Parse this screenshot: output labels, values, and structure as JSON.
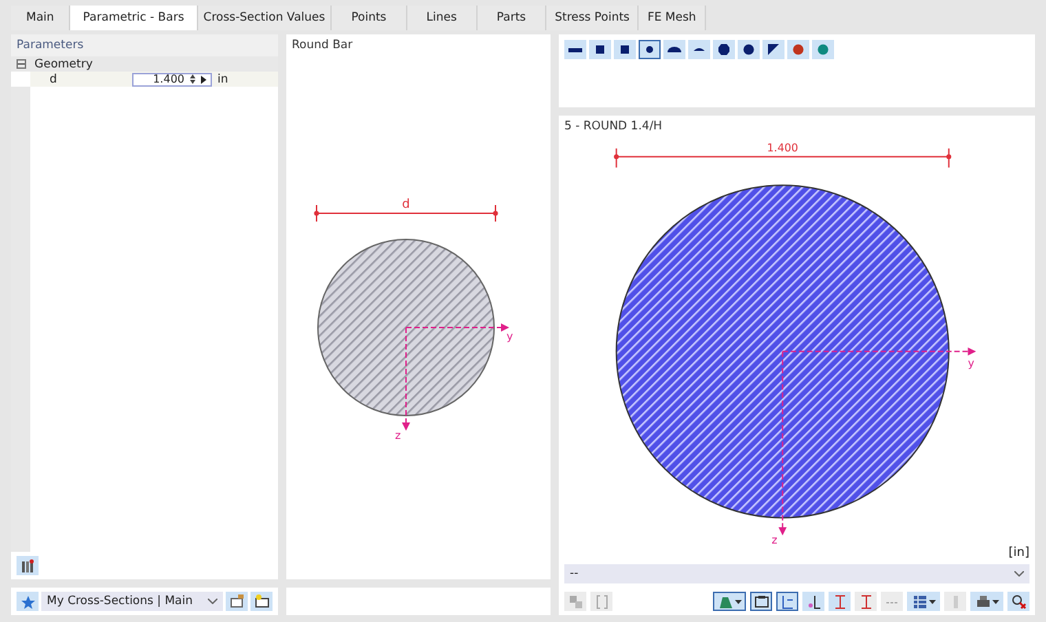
{
  "tabs": [
    {
      "label": "Main",
      "selected": false
    },
    {
      "label": "Parametric - Bars",
      "selected": true
    },
    {
      "label": "Cross-Section Values",
      "selected": false
    },
    {
      "label": "Points",
      "selected": false
    },
    {
      "label": "Lines",
      "selected": false
    },
    {
      "label": "Parts",
      "selected": false
    },
    {
      "label": "Stress Points",
      "selected": false
    },
    {
      "label": "FE Mesh",
      "selected": false
    }
  ],
  "parameters": {
    "title": "Parameters",
    "groups": [
      {
        "label": "Geometry",
        "expanded": true,
        "children": [
          {
            "name": "d",
            "value": "1.400",
            "unit": "in"
          }
        ]
      }
    ]
  },
  "library_selector": {
    "value": "My Cross-Sections | Main"
  },
  "sketch": {
    "title": "Round Bar",
    "dimension_label": "d",
    "axis_y": "y",
    "axis_z": "z"
  },
  "shapes": [
    {
      "kind": "flat",
      "selected": false,
      "color": "#0a1f6e"
    },
    {
      "kind": "square",
      "selected": false,
      "color": "#0a1f6e"
    },
    {
      "kind": "square",
      "selected": false,
      "color": "#0a1f6e"
    },
    {
      "kind": "dot",
      "selected": true,
      "color": "#0a1f6e"
    },
    {
      "kind": "half",
      "selected": false,
      "color": "#0a1f6e"
    },
    {
      "kind": "segment",
      "selected": false,
      "color": "#0a1f6e"
    },
    {
      "kind": "octagon",
      "selected": false,
      "color": "#0a1f6e"
    },
    {
      "kind": "circle",
      "selected": false,
      "color": "#0a1f6e"
    },
    {
      "kind": "triangle",
      "selected": false,
      "color": "#0a1f6e"
    },
    {
      "kind": "diamond",
      "selected": false,
      "color": "#c0341d"
    },
    {
      "kind": "diamond",
      "selected": false,
      "color": "#0f8a80"
    }
  ],
  "preview": {
    "title": "5 - ROUND 1.4/H",
    "dimension_label": "1.400",
    "axis_y": "y",
    "axis_z": "z",
    "unit": "[in]",
    "selector": "--"
  },
  "toolbar": [
    {
      "kind": "swap",
      "disabled": true,
      "selected": false,
      "dropdown": false
    },
    {
      "kind": "bracket",
      "disabled": true,
      "selected": false,
      "dropdown": false
    },
    {
      "kind": "view",
      "disabled": false,
      "selected": true,
      "dropdown": true
    },
    {
      "kind": "frame",
      "disabled": false,
      "selected": true,
      "dropdown": false
    },
    {
      "kind": "axes",
      "disabled": false,
      "selected": true,
      "dropdown": false
    },
    {
      "kind": "points",
      "disabled": false,
      "selected": false,
      "dropdown": false
    },
    {
      "kind": "ibeam",
      "disabled": false,
      "selected": false,
      "dropdown": false
    },
    {
      "kind": "ibeam",
      "disabled": true,
      "selected": false,
      "dropdown": false
    },
    {
      "kind": "dashes",
      "disabled": true,
      "selected": false,
      "dropdown": false
    },
    {
      "kind": "grid",
      "disabled": false,
      "selected": false,
      "dropdown": true
    },
    {
      "kind": "ruler",
      "disabled": true,
      "selected": false,
      "dropdown": false
    },
    {
      "kind": "print",
      "disabled": false,
      "selected": false,
      "dropdown": true
    },
    {
      "kind": "close",
      "disabled": false,
      "selected": false,
      "dropdown": false
    }
  ]
}
